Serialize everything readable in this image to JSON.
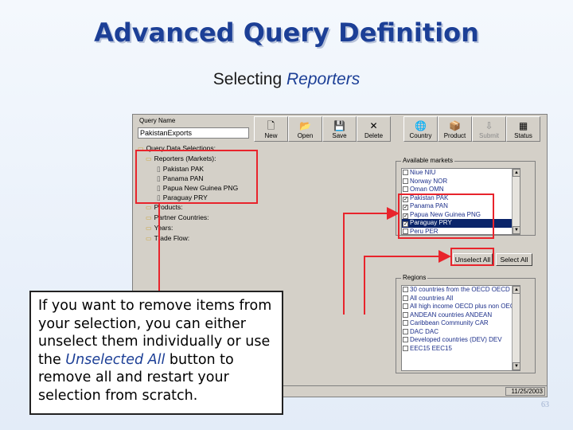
{
  "slide": {
    "title": "Advanced Query Definition",
    "subtitle_plain": "Selecting",
    "subtitle_accent": "Reporters",
    "page_number": "63"
  },
  "app": {
    "query_name_label": "Query Name",
    "query_name_value": "PakistanExports",
    "toolbar_left": [
      {
        "label": "New",
        "icon": "new-document-icon",
        "glyph": "🗋"
      },
      {
        "label": "Open",
        "icon": "open-folder-icon",
        "glyph": "📂"
      },
      {
        "label": "Save",
        "icon": "save-disk-icon",
        "glyph": "💾"
      },
      {
        "label": "Delete",
        "icon": "delete-x-icon",
        "glyph": "✕"
      }
    ],
    "toolbar_right": [
      {
        "label": "Country",
        "icon": "globe-icon",
        "glyph": "🌐"
      },
      {
        "label": "Product",
        "icon": "product-icon",
        "glyph": "📦"
      },
      {
        "label": "Submit",
        "icon": "submit-icon",
        "glyph": "⇩",
        "disabled": true
      },
      {
        "label": "Status",
        "icon": "status-icon",
        "glyph": "▦"
      }
    ],
    "tree": {
      "root": "Query Data Selections:",
      "reporters_label": "Reporters (Markets):",
      "reporters": [
        "Pakistan  PAK",
        "Panama  PAN",
        "Papua New Guinea  PNG",
        "Paraguay  PRY"
      ],
      "others": [
        "Products:",
        "Partner Countries:",
        "Years:",
        "Trade Flow:"
      ]
    },
    "available_caption": "Available markets",
    "available_items": [
      {
        "label": "Niue  NIU",
        "checked": false
      },
      {
        "label": "Norway  NOR",
        "checked": false
      },
      {
        "label": "Oman  OMN",
        "checked": false
      },
      {
        "label": "Pakistan  PAK",
        "checked": true
      },
      {
        "label": "Panama  PAN",
        "checked": true
      },
      {
        "label": "Papua New Guinea  PNG",
        "checked": true
      },
      {
        "label": "Paraguay  PRY",
        "checked": true,
        "selected": true
      },
      {
        "label": "Peru  PER",
        "checked": false
      }
    ],
    "unselect_all_label": "Unselect All",
    "select_all_label": "Select All",
    "regions_caption": "Regions",
    "regions_items": [
      "30 countries from the OECD  OECD",
      "All countries  All",
      "All high income OECD plus non OECD",
      "ANDEAN countries  ANDEAN",
      "Caribbean Community  CAR",
      "DAC  DAC",
      "Developed countries (DEV)  DEV",
      "EEC15  EEC15"
    ],
    "status_date": "11/25/2003"
  },
  "callout": {
    "text_before": "If you want to remove items from your selection, you can either unselect them individually or use the ",
    "text_accent": "Unselected All",
    "text_after": " button to remove all and restart your selection from scratch."
  },
  "colors": {
    "title": "#1c3f96",
    "highlight": "#e8242c",
    "selection": "#0a246a"
  }
}
